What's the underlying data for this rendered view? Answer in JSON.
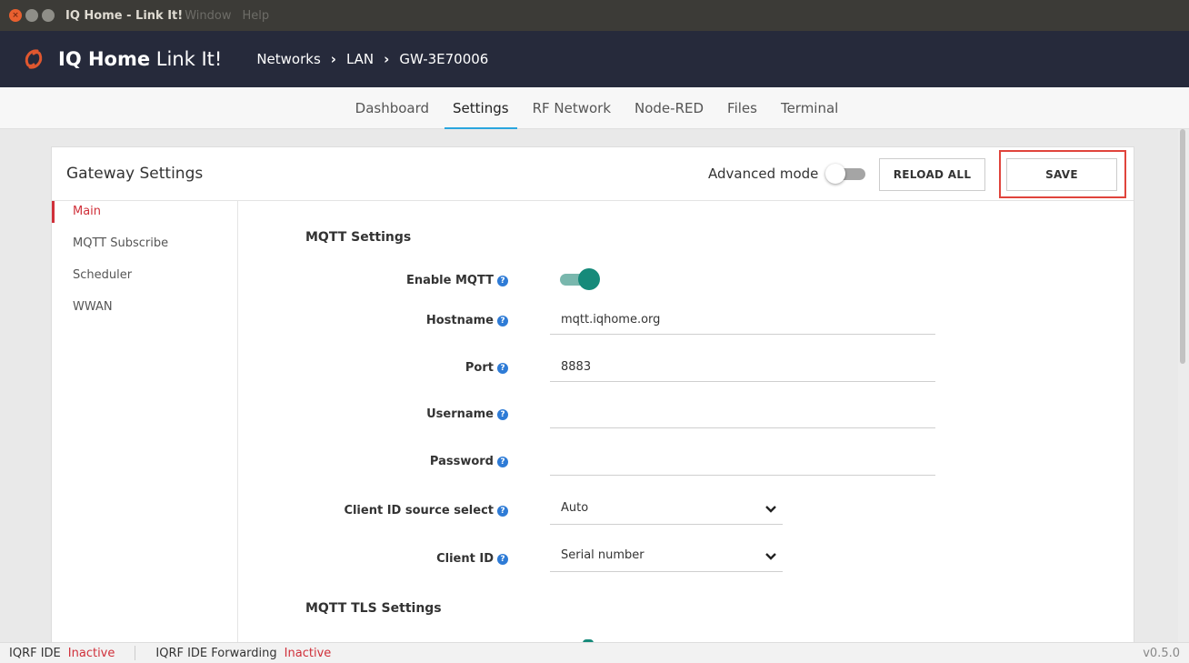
{
  "os": {
    "title": "IQ Home - Link It!",
    "menu": [
      "Window",
      "Help"
    ]
  },
  "header": {
    "brand_bold": "IQ Home",
    "brand_light": "Link It!",
    "breadcrumb": [
      "Networks",
      "LAN",
      "GW-3E70006"
    ]
  },
  "tabs": [
    "Dashboard",
    "Settings",
    "RF Network",
    "Node-RED",
    "Files",
    "Terminal"
  ],
  "active_tab": "Settings",
  "card": {
    "title": "Gateway Settings",
    "advanced_mode_label": "Advanced mode",
    "advanced_mode_on": false,
    "reload_label": "RELOAD ALL",
    "save_label": "SAVE"
  },
  "sidenav": [
    "Main",
    "MQTT Subscribe",
    "Scheduler",
    "WWAN"
  ],
  "active_nav": "Main",
  "form": {
    "section_mqtt": "MQTT Settings",
    "enable_mqtt_label": "Enable MQTT",
    "enable_mqtt_on": true,
    "hostname_label": "Hostname",
    "hostname_value": "mqtt.iqhome.org",
    "port_label": "Port",
    "port_value": "8883",
    "username_label": "Username",
    "username_value": "",
    "password_label": "Password",
    "password_value": "",
    "client_id_source_label": "Client ID source select",
    "client_id_source_value": "Auto",
    "client_id_label": "Client ID",
    "client_id_value": "Serial number",
    "section_tls": "MQTT TLS Settings"
  },
  "status": {
    "iqrf_ide_label": "IQRF IDE",
    "iqrf_ide_value": "Inactive",
    "forwarding_label": "IQRF IDE Forwarding",
    "forwarding_value": "Inactive",
    "version": "v0.5.0"
  },
  "colors": {
    "header_bg": "#262a3b",
    "accent_blue": "#2aa6de",
    "toggle_green": "#168a7a",
    "active_red": "#d0303a",
    "highlight_red": "#e0443c"
  }
}
